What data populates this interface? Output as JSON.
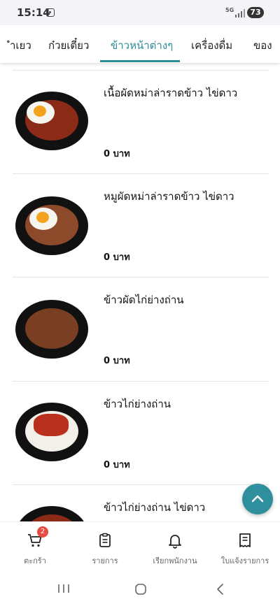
{
  "status_bar": {
    "time": "15:14",
    "network": "5G",
    "battery": "73"
  },
  "tabs": [
    {
      "label": "ำเยว"
    },
    {
      "label": "ก๋วยเตี๋ยว"
    },
    {
      "label": "ข้าวหน้าต่างๆ"
    },
    {
      "label": "เครื่องดื่ม"
    },
    {
      "label": "ของ"
    }
  ],
  "active_tab": "ข้าวหน้าต่างๆ",
  "menu_items": [
    {
      "name": "เนื้อผัดหม่าล่าราดข้าว ไข่ดาว",
      "price": "0 บาท"
    },
    {
      "name": "หมูผัดหม่าล่าราดข้าว ไข่ดาว",
      "price": "0 บาท"
    },
    {
      "name": "ข้าวผัดไก่ย่างถ่าน",
      "price": "0 บาท"
    },
    {
      "name": "ข้าวไก่ย่างถ่าน",
      "price": "0 บาท"
    },
    {
      "name": "ข้าวไก่ย่างถ่าน ไข่ดาว",
      "price": ""
    }
  ],
  "bottom_nav": [
    {
      "label": "ตะกร้า",
      "icon": "cart-icon",
      "badge": "2"
    },
    {
      "label": "รายการ",
      "icon": "clipboard-icon"
    },
    {
      "label": "เรียกพนักงาน",
      "icon": "bell-icon"
    },
    {
      "label": "ใบแจ้งรายการ",
      "icon": "receipt-icon"
    }
  ],
  "colors": {
    "accent": "#2b8c99",
    "badge": "#e84b43"
  }
}
